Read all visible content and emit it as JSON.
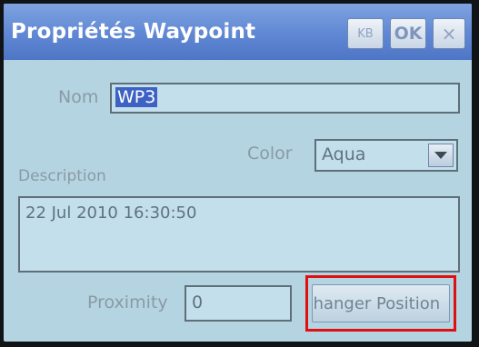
{
  "window": {
    "title": "Propriétés Waypoint",
    "kb_label": "KB",
    "ok_label": "OK",
    "close_label": "×"
  },
  "form": {
    "name_label": "Nom",
    "name_value": "WP3",
    "color_label": "Color",
    "color_value": "Aqua",
    "description_label": "Description",
    "description_value": "22 Jul 2010 16:30:50",
    "proximity_label": "Proximity",
    "proximity_value": "0",
    "change_position_label": "Changer Position"
  },
  "colors": {
    "titlebar": "#5f87d3",
    "window_bg": "#b4d4e2",
    "highlight_box": "#e11010",
    "selection": "#3d62c4"
  },
  "icons": {
    "dropdown": "chevron-down-icon"
  }
}
